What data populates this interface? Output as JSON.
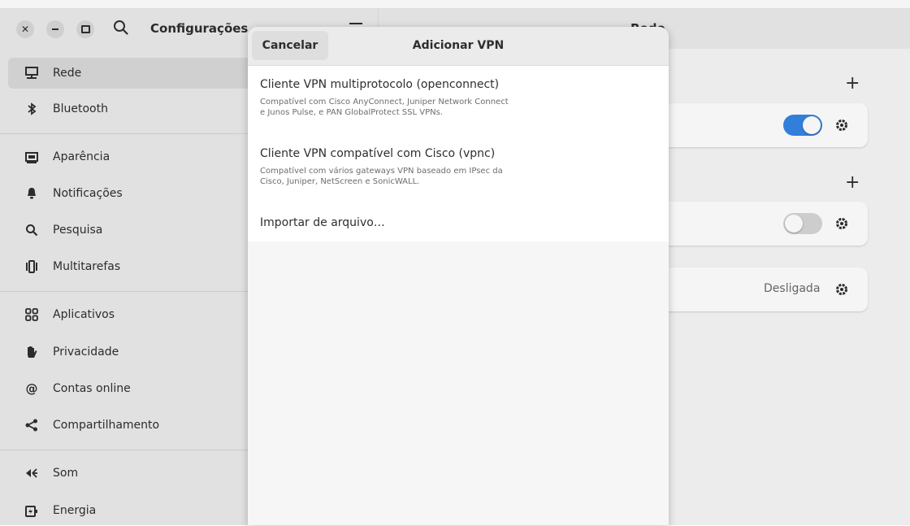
{
  "window": {
    "app_title": "Configurações",
    "content_title": "Rede"
  },
  "sidebar": {
    "items": [
      {
        "label": "Rede",
        "icon": "network-icon"
      },
      {
        "label": "Bluetooth",
        "icon": "bluetooth-icon"
      },
      {
        "label": "Aparência",
        "icon": "appearance-icon"
      },
      {
        "label": "Notificações",
        "icon": "bell-icon"
      },
      {
        "label": "Pesquisa",
        "icon": "search-icon"
      },
      {
        "label": "Multitarefas",
        "icon": "multitasking-icon"
      },
      {
        "label": "Aplicativos",
        "icon": "apps-grid-icon"
      },
      {
        "label": "Privacidade",
        "icon": "hand-icon"
      },
      {
        "label": "Contas online",
        "icon": "at-sign-icon"
      },
      {
        "label": "Compartilhamento",
        "icon": "share-icon"
      },
      {
        "label": "Som",
        "icon": "speaker-icon"
      },
      {
        "label": "Energia",
        "icon": "power-icon"
      }
    ],
    "active_index": 0
  },
  "content": {
    "wired": {
      "toggle_on": true
    },
    "vpn": {
      "toggle_on": false
    },
    "proxy": {
      "status": "Desligada"
    }
  },
  "dialog": {
    "title": "Adicionar VPN",
    "cancel_label": "Cancelar",
    "options": [
      {
        "title": "Cliente VPN multiprotocolo (openconnect)",
        "description": "Compatível com Cisco AnyConnect, Juniper Network Connect e Junos Pulse, e PAN GlobalProtect SSL VPNs."
      },
      {
        "title": "Cliente VPN compatível com Cisco (vpnc)",
        "description": "Compatível com vários gateways VPN baseado em IPsec da Cisco, Juniper, NetScreen e SonicWALL."
      },
      {
        "title": "Importar de arquivo…"
      }
    ]
  },
  "colors": {
    "accent": "#3584e4"
  }
}
